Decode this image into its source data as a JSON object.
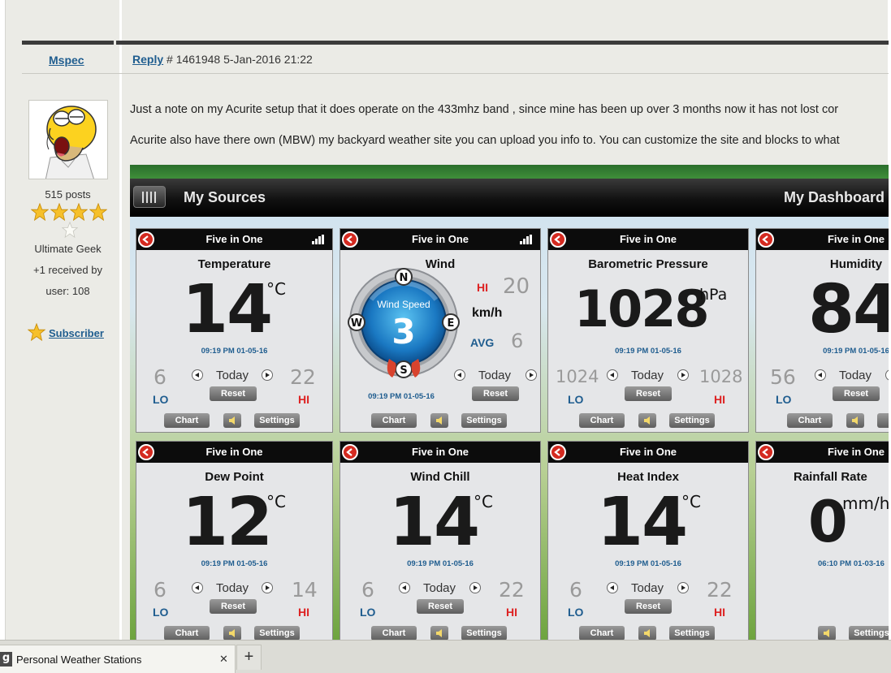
{
  "post": {
    "username": "Mspec",
    "reply_label": "Reply",
    "meta": "# 1461948 5-Jan-2016 21:22",
    "posts_count": "515 posts",
    "rank": "Ultimate Geek",
    "received": "+1 received by",
    "user_id": "user: 108",
    "subscriber": "Subscriber",
    "line1": "Just a note on my Acurite setup that it does operate on the 433mhz band , since mine has been up over 3 months now it has not lost cor",
    "line2": "Acurite also have there own (MBW) my backyard weather site you can upload you info to. You can customize the site and blocks to what"
  },
  "dashboard": {
    "left_title": "My Sources",
    "right_title": "My Dashboard",
    "source_label": "Five in One",
    "today": "Today",
    "reset": "Reset",
    "chart": "Chart",
    "settings": "Settings",
    "lo": "LO",
    "hi": "HI",
    "cards": [
      {
        "title": "Temperature",
        "value": "14",
        "unit": "°C",
        "stamp": "09:19 PM 01-05-16",
        "lo": "6",
        "hi": "22"
      },
      {
        "title": "Wind",
        "gauge_label": "Wind Speed",
        "value": "3",
        "unit": "km/h",
        "hi_label": "HI",
        "hi": "20",
        "avg_label": "AVG",
        "avg": "6",
        "stamp": "09:19 PM 01-05-16",
        "n": "N",
        "e": "E",
        "s": "S",
        "w": "W"
      },
      {
        "title": "Barometric Pressure",
        "value": "1028",
        "unit": "hPa",
        "stamp": "09:19 PM 01-05-16",
        "lo": "1024",
        "hi": "1028"
      },
      {
        "title": "Humidity",
        "value": "84",
        "stamp": "09:19 PM 01-05-16",
        "lo": "56",
        "settings_cut": "Se"
      },
      {
        "title": "Dew Point",
        "value": "12",
        "unit": "°C",
        "stamp": "09:19 PM 01-05-16",
        "lo": "6",
        "hi": "14"
      },
      {
        "title": "Wind Chill",
        "value": "14",
        "unit": "°C",
        "stamp": "09:19 PM 01-05-16",
        "lo": "6",
        "hi": "22"
      },
      {
        "title": "Heat Index",
        "value": "14",
        "unit": "°C",
        "stamp": "09:19 PM 01-05-16",
        "lo": "6",
        "hi": "22"
      },
      {
        "title": "Rainfall Rate",
        "value": "0",
        "unit": "mm/h",
        "stamp": "06:10 PM 01-03-16"
      }
    ]
  },
  "browser": {
    "tab_icon": "g",
    "tab_title": "Personal Weather Stations",
    "tab_close": "✕",
    "new_tab": "+"
  }
}
